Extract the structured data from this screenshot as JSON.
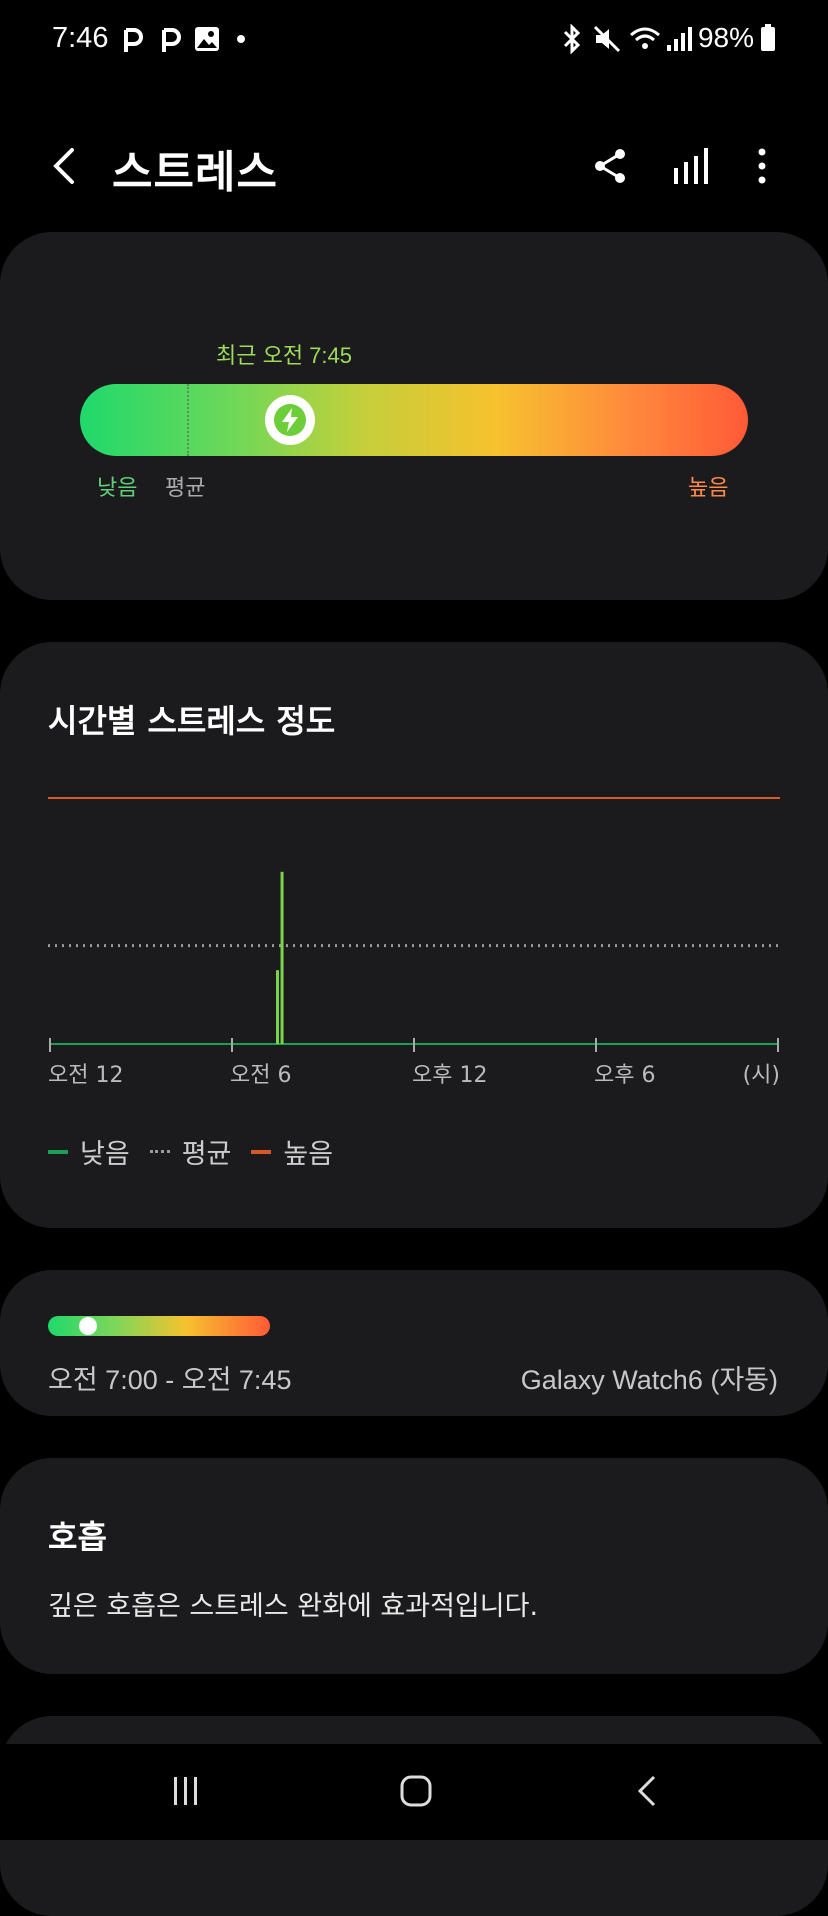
{
  "status_bar": {
    "time": "7:46",
    "notif_icons": [
      "p-app-icon",
      "p-app-icon",
      "gallery-icon",
      "dot-icon"
    ],
    "battery": "98%"
  },
  "app_bar": {
    "title": "스트레스"
  },
  "stress_gauge": {
    "recent_label": "최근 오전 7:45",
    "low_label": "낮음",
    "avg_label": "평균",
    "high_label": "높음",
    "current_level_fraction": 0.3,
    "average_level_fraction": 0.16
  },
  "hourly": {
    "title": "시간별 스트레스 정도",
    "x_ticks": [
      "오전 12",
      "오전 6",
      "오후 12",
      "오후 6",
      "(시)"
    ],
    "legend": {
      "low": "낮음",
      "avg": "평균",
      "high": "높음"
    },
    "colors": {
      "low": "#1e9e52",
      "avg": "#9a9a9a",
      "high": "#d9582a"
    }
  },
  "chart_data": {
    "type": "bar",
    "title": "시간별 스트레스 정도",
    "xlabel": "(시)",
    "x_ticks": [
      "오전 12",
      "오전 6",
      "오후 12",
      "오후 6"
    ],
    "xlim": [
      0,
      24
    ],
    "ylim": [
      0,
      100
    ],
    "average": 40,
    "high_threshold": 100,
    "bars": [
      {
        "x": 7.5,
        "value": 30
      },
      {
        "x": 7.65,
        "value": 70
      }
    ]
  },
  "latest_measure": {
    "time_range": "오전 7:00 - 오전 7:45",
    "device": "Galaxy Watch6 (자동)",
    "level_fraction": 0.18
  },
  "breathing": {
    "title": "호흡",
    "description": "깊은 호흡은 스트레스 완화에 효과적입니다."
  }
}
